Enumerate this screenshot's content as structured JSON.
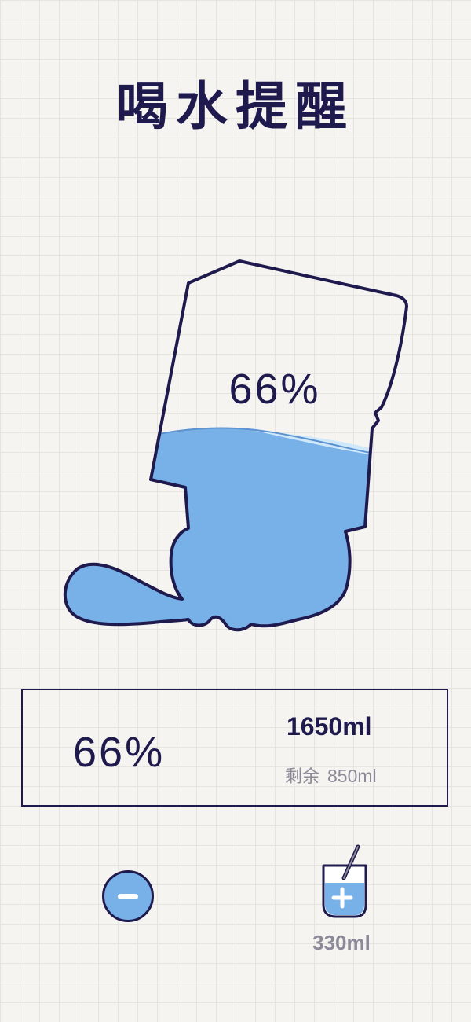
{
  "header": {
    "title": "喝水提醒"
  },
  "cup": {
    "fill_percent": 66,
    "percent_label": "66%",
    "water_color": "#78b0e8",
    "highlight_color": "#cfe9fb",
    "outline_color": "#1f1a4d"
  },
  "stats": {
    "percent_label": "66%",
    "total_label": "1650ml",
    "remaining_label": "剩余",
    "remaining_value": "850ml"
  },
  "controls": {
    "minus_icon": "minus-circle-icon",
    "add_icon": "glass-with-straw-plus-icon",
    "add_amount_label": "330ml"
  },
  "colors": {
    "background": "#f5f4f0",
    "grid": "#e6e4de",
    "primary_text": "#1f1a4d",
    "secondary_text": "#8c8a99",
    "accent_blue": "#78b0e8"
  }
}
